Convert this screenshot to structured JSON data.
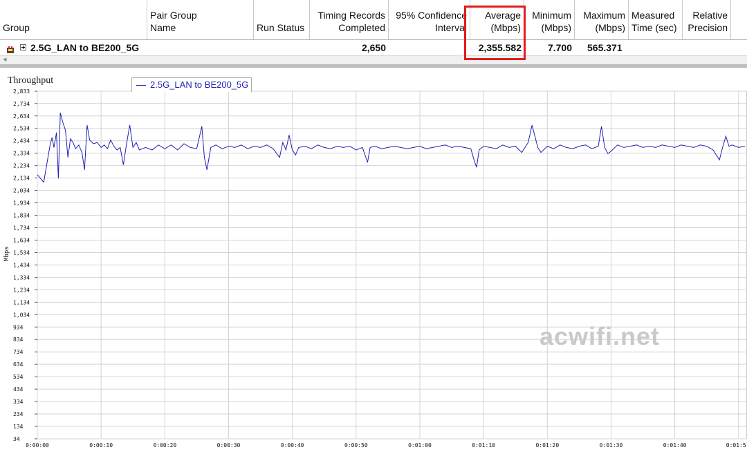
{
  "table": {
    "columns": [
      {
        "label": "Group"
      },
      {
        "label": "Pair Group\nName"
      },
      {
        "label": "Run Status"
      },
      {
        "label": "Timing Records\nCompleted"
      },
      {
        "label": "95% Confidence\nInterval"
      },
      {
        "label": "Average\n(Mbps)"
      },
      {
        "label": "Minimum\n(Mbps)"
      },
      {
        "label": "Maximum\n(Mbps)"
      },
      {
        "label": "Measured\nTime (sec)"
      },
      {
        "label": "Relative\nPrecision"
      }
    ],
    "row": {
      "group": "2.5G_LAN to BE200_5G",
      "pair_group_name": "",
      "run_status": "",
      "timing_records": "2,650",
      "confidence": "",
      "average": "2,355.582",
      "minimum": "7.700",
      "maximum": "565.371",
      "measured_time": "",
      "relative_precision": ""
    },
    "highlight_color": "#e21b1b"
  },
  "chart_title": "Throughput",
  "legend_label": "2.5G_LAN to BE200_5G",
  "ylabel": "Mbps",
  "watermark": "acwifi.net",
  "chart_data": {
    "type": "line",
    "title": "Throughput",
    "ylabel": "Mbps",
    "xlabel": "",
    "ylim": [
      34,
      2833
    ],
    "y_ticks": [
      2833,
      2734,
      2634,
      2534,
      2434,
      2334,
      2234,
      2134,
      2034,
      1934,
      1834,
      1734,
      1634,
      1534,
      1434,
      1334,
      1234,
      1134,
      1034,
      934,
      834,
      734,
      634,
      534,
      434,
      334,
      234,
      134,
      34
    ],
    "y_tick_labels": [
      "2,833",
      "2,734",
      "2,634",
      "2,534",
      "2,434",
      "2,334",
      "2,234",
      "2,134",
      "2,034",
      "1,934",
      "1,834",
      "1,734",
      "1,634",
      "1,534",
      "1,434",
      "1,334",
      "1,234",
      "1,134",
      "1,034",
      "934",
      "834",
      "734",
      "634",
      "534",
      "434",
      "334",
      "234",
      "134",
      "34"
    ],
    "x_ticks": [
      0,
      10,
      20,
      30,
      40,
      50,
      60,
      70,
      80,
      90,
      100,
      110
    ],
    "x_tick_labels": [
      "0:00:00",
      "0:00:10",
      "0:00:20",
      "0:00:30",
      "0:00:40",
      "0:00:50",
      "0:01:00",
      "0:01:10",
      "0:01:20",
      "0:01:30",
      "0:01:40",
      "0:01:5"
    ],
    "xlim": [
      0,
      111
    ],
    "grid": true,
    "series": [
      {
        "name": "2.5G_LAN to BE200_5G",
        "color": "#1f1fb4",
        "points": [
          [
            0,
            2160
          ],
          [
            0.5,
            2130
          ],
          [
            1,
            2100
          ],
          [
            1.5,
            2250
          ],
          [
            2,
            2400
          ],
          [
            2.3,
            2460
          ],
          [
            2.6,
            2380
          ],
          [
            3,
            2500
          ],
          [
            3.3,
            2130
          ],
          [
            3.6,
            2660
          ],
          [
            4,
            2580
          ],
          [
            4.4,
            2520
          ],
          [
            4.8,
            2300
          ],
          [
            5.2,
            2450
          ],
          [
            5.6,
            2420
          ],
          [
            6,
            2370
          ],
          [
            6.5,
            2400
          ],
          [
            7,
            2340
          ],
          [
            7.4,
            2200
          ],
          [
            7.8,
            2560
          ],
          [
            8.2,
            2440
          ],
          [
            8.8,
            2410
          ],
          [
            9.4,
            2420
          ],
          [
            10,
            2380
          ],
          [
            10.5,
            2400
          ],
          [
            11,
            2370
          ],
          [
            11.5,
            2440
          ],
          [
            12,
            2390
          ],
          [
            12.5,
            2360
          ],
          [
            13,
            2380
          ],
          [
            13.5,
            2240
          ],
          [
            14,
            2410
          ],
          [
            14.5,
            2560
          ],
          [
            15,
            2380
          ],
          [
            15.5,
            2420
          ],
          [
            16,
            2360
          ],
          [
            17,
            2380
          ],
          [
            18,
            2360
          ],
          [
            19,
            2400
          ],
          [
            20,
            2370
          ],
          [
            21,
            2400
          ],
          [
            22,
            2360
          ],
          [
            23,
            2410
          ],
          [
            24,
            2380
          ],
          [
            25,
            2370
          ],
          [
            25.8,
            2550
          ],
          [
            26.2,
            2300
          ],
          [
            26.6,
            2200
          ],
          [
            27.2,
            2380
          ],
          [
            28,
            2400
          ],
          [
            29,
            2370
          ],
          [
            30,
            2390
          ],
          [
            31,
            2380
          ],
          [
            32,
            2400
          ],
          [
            33,
            2370
          ],
          [
            34,
            2390
          ],
          [
            35,
            2380
          ],
          [
            36,
            2400
          ],
          [
            37,
            2370
          ],
          [
            38,
            2300
          ],
          [
            38.5,
            2420
          ],
          [
            39,
            2360
          ],
          [
            39.5,
            2480
          ],
          [
            40,
            2360
          ],
          [
            40.5,
            2320
          ],
          [
            41,
            2380
          ],
          [
            42,
            2390
          ],
          [
            43,
            2370
          ],
          [
            44,
            2400
          ],
          [
            45,
            2380
          ],
          [
            46,
            2370
          ],
          [
            47,
            2390
          ],
          [
            48,
            2380
          ],
          [
            49,
            2390
          ],
          [
            50,
            2360
          ],
          [
            51,
            2380
          ],
          [
            51.8,
            2260
          ],
          [
            52.2,
            2380
          ],
          [
            53,
            2390
          ],
          [
            54,
            2370
          ],
          [
            55,
            2380
          ],
          [
            56,
            2390
          ],
          [
            57,
            2380
          ],
          [
            58,
            2370
          ],
          [
            59,
            2380
          ],
          [
            60,
            2390
          ],
          [
            61,
            2370
          ],
          [
            62,
            2380
          ],
          [
            63,
            2390
          ],
          [
            64,
            2400
          ],
          [
            65,
            2380
          ],
          [
            66,
            2390
          ],
          [
            67,
            2380
          ],
          [
            68,
            2370
          ],
          [
            68.5,
            2280
          ],
          [
            68.9,
            2220
          ],
          [
            69.3,
            2360
          ],
          [
            70,
            2390
          ],
          [
            71,
            2380
          ],
          [
            72,
            2370
          ],
          [
            73,
            2400
          ],
          [
            74,
            2380
          ],
          [
            75,
            2390
          ],
          [
            76,
            2340
          ],
          [
            77,
            2420
          ],
          [
            77.6,
            2560
          ],
          [
            78,
            2480
          ],
          [
            78.5,
            2380
          ],
          [
            79,
            2340
          ],
          [
            80,
            2390
          ],
          [
            81,
            2370
          ],
          [
            82,
            2400
          ],
          [
            83,
            2380
          ],
          [
            84,
            2370
          ],
          [
            85,
            2390
          ],
          [
            86,
            2400
          ],
          [
            87,
            2370
          ],
          [
            88,
            2390
          ],
          [
            88.5,
            2550
          ],
          [
            89,
            2380
          ],
          [
            89.5,
            2330
          ],
          [
            90,
            2350
          ],
          [
            91,
            2400
          ],
          [
            92,
            2380
          ],
          [
            93,
            2390
          ],
          [
            94,
            2400
          ],
          [
            95,
            2380
          ],
          [
            96,
            2390
          ],
          [
            97,
            2380
          ],
          [
            98,
            2400
          ],
          [
            99,
            2390
          ],
          [
            100,
            2380
          ],
          [
            101,
            2400
          ],
          [
            102,
            2390
          ],
          [
            103,
            2380
          ],
          [
            104,
            2400
          ],
          [
            105,
            2390
          ],
          [
            106,
            2360
          ],
          [
            107,
            2280
          ],
          [
            107.5,
            2380
          ],
          [
            108,
            2470
          ],
          [
            108.5,
            2390
          ],
          [
            109,
            2400
          ],
          [
            110,
            2380
          ],
          [
            111,
            2390
          ]
        ]
      }
    ]
  }
}
